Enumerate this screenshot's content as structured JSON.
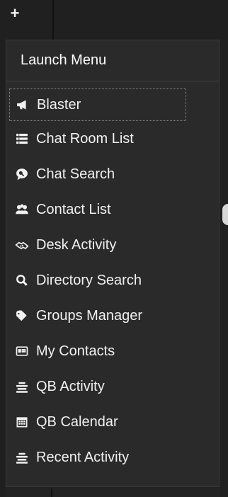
{
  "topbar": {
    "plus_symbol": "+"
  },
  "menu": {
    "title": "Launch Menu",
    "items": [
      {
        "label": "Blaster",
        "icon": "megaphone-icon",
        "state": "active"
      },
      {
        "label": "Chat Room List",
        "icon": "list-icon",
        "state": "normal"
      },
      {
        "label": "Chat Search",
        "icon": "chat-search-icon",
        "state": "normal"
      },
      {
        "label": "Contact List",
        "icon": "users-icon",
        "state": "normal"
      },
      {
        "label": "Desk Activity",
        "icon": "handshake-icon",
        "state": "normal"
      },
      {
        "label": "Directory Search",
        "icon": "search-icon",
        "state": "normal"
      },
      {
        "label": "Groups Manager",
        "icon": "tags-icon",
        "state": "normal"
      },
      {
        "label": "My Contacts",
        "icon": "contact-card-icon",
        "state": "normal"
      },
      {
        "label": "QB Activity",
        "icon": "activity-lines-icon",
        "state": "normal"
      },
      {
        "label": "QB Calendar",
        "icon": "calendar-icon",
        "state": "normal"
      },
      {
        "label": "Recent Activity",
        "icon": "activity-lines-icon",
        "state": "normal"
      }
    ]
  },
  "colors": {
    "background": "#232323",
    "menu_background": "#2a2a2a",
    "text": "#f1f1f1",
    "border": "#444444"
  }
}
